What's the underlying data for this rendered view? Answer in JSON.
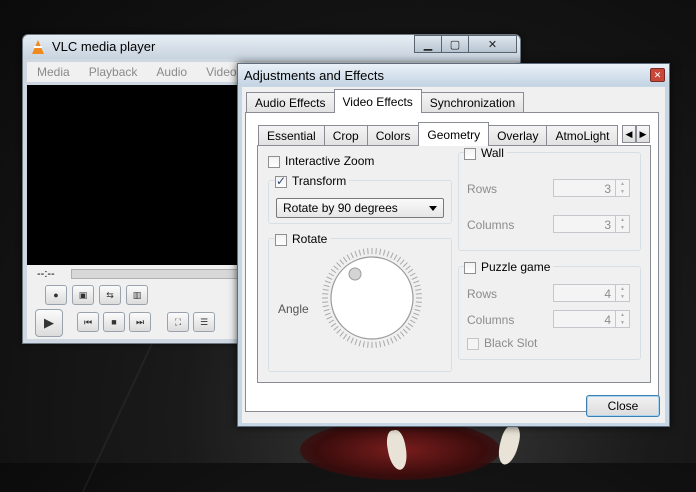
{
  "vlc": {
    "title": "VLC media player",
    "menu": [
      "Media",
      "Playback",
      "Audio",
      "Video"
    ],
    "time": "--:--"
  },
  "dialog": {
    "title": "Adjustments and Effects",
    "top_tabs": [
      "Audio Effects",
      "Video Effects",
      "Synchronization"
    ],
    "active_top_tab": "Video Effects",
    "inner_tabs": [
      "Essential",
      "Crop",
      "Colors",
      "Geometry",
      "Overlay",
      "AtmoLight"
    ],
    "active_inner_tab": "Geometry",
    "interactive_zoom": {
      "label": "Interactive Zoom",
      "checked": false
    },
    "transform": {
      "label": "Transform",
      "checked": true,
      "selected": "Rotate by 90 degrees"
    },
    "rotate": {
      "label": "Rotate",
      "checked": false,
      "angle_label": "Angle"
    },
    "wall": {
      "label": "Wall",
      "checked": false,
      "rows_label": "Rows",
      "rows_value": "3",
      "columns_label": "Columns",
      "columns_value": "3"
    },
    "puzzle": {
      "label": "Puzzle game",
      "checked": false,
      "rows_label": "Rows",
      "rows_value": "4",
      "columns_label": "Columns",
      "columns_value": "4",
      "black_slot_label": "Black Slot"
    },
    "close_label": "Close"
  },
  "colors": {
    "dialog_frame": "#c7d6e5",
    "focus_border": "#3c7fb1",
    "cone": "#f08a1e"
  }
}
